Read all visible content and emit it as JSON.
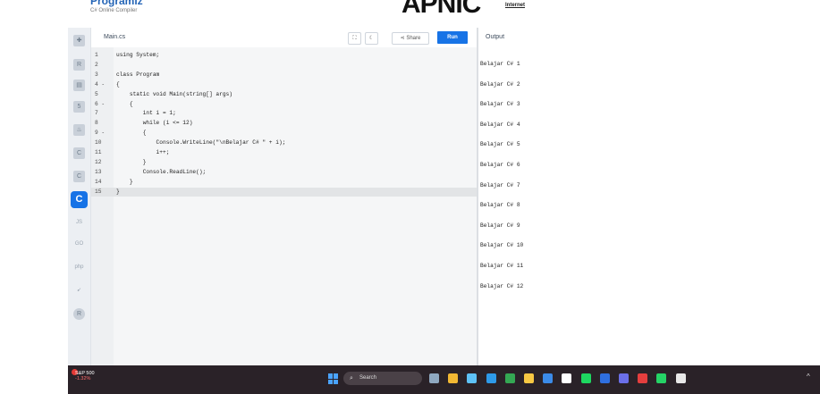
{
  "header": {
    "brand": "Programiz",
    "subtitle": "C# Online Compiler",
    "ad_logo": "APNIC",
    "ad_text": "Internet"
  },
  "sidebar": {
    "items": [
      {
        "icon": "python-icon",
        "glyph": "✚"
      },
      {
        "icon": "r-icon",
        "glyph": "R"
      },
      {
        "icon": "sql-icon",
        "glyph": "▤"
      },
      {
        "icon": "html-icon",
        "glyph": "5"
      },
      {
        "icon": "java-icon",
        "glyph": "♨"
      },
      {
        "icon": "c-icon",
        "glyph": "C"
      },
      {
        "icon": "cpp-icon",
        "glyph": "C"
      },
      {
        "icon": "csharp-icon",
        "glyph": "C"
      },
      {
        "icon": "js-icon",
        "glyph": "JS"
      },
      {
        "icon": "go-icon",
        "glyph": "GO"
      },
      {
        "icon": "php-icon",
        "glyph": "php"
      },
      {
        "icon": "swift-icon",
        "glyph": "➹"
      },
      {
        "icon": "rust-icon",
        "glyph": "R"
      }
    ]
  },
  "editor": {
    "filename": "Main.cs",
    "share_label": "Share",
    "run_label": "Run",
    "lines": [
      {
        "n": "1",
        "text": "using System;"
      },
      {
        "n": "2",
        "text": ""
      },
      {
        "n": "3",
        "text": "class Program"
      },
      {
        "n": "4 -",
        "text": "{"
      },
      {
        "n": "5",
        "text": "    static void Main(string[] args)"
      },
      {
        "n": "6 -",
        "text": "    {"
      },
      {
        "n": "7",
        "text": "        int i = 1;"
      },
      {
        "n": "8",
        "text": "        while (i <= 12)"
      },
      {
        "n": "9 -",
        "text": "        {"
      },
      {
        "n": "10",
        "text": "            Console.WriteLine(\"\\nBelajar C# \" + i);"
      },
      {
        "n": "11",
        "text": "            i++;"
      },
      {
        "n": "12",
        "text": "        }"
      },
      {
        "n": "13",
        "text": "        Console.ReadLine();"
      },
      {
        "n": "14",
        "text": "    }"
      },
      {
        "n": "15",
        "text": "}"
      }
    ]
  },
  "output": {
    "title": "Output",
    "lines": [
      "Belajar C# 1",
      "Belajar C# 2",
      "Belajar C# 3",
      "Belajar C# 4",
      "Belajar C# 5",
      "Belajar C# 6",
      "Belajar C# 7",
      "Belajar C# 8",
      "Belajar C# 9",
      "Belajar C# 10",
      "Belajar C# 11",
      "Belajar C# 12"
    ]
  },
  "taskbar": {
    "stock_name": "S&P 500",
    "stock_change": "-1.32%",
    "search_placeholder": "Search",
    "apps": [
      {
        "name": "tigers-widget-icon",
        "color": "#8fa8c0"
      },
      {
        "name": "file-explorer-icon",
        "color": "#f2b833"
      },
      {
        "name": "copilot-icon",
        "color": "#5ec2f7"
      },
      {
        "name": "edge-icon",
        "color": "#2e9ae8"
      },
      {
        "name": "chrome-icon",
        "color": "#34a853"
      },
      {
        "name": "folder-icon",
        "color": "#f7c843"
      },
      {
        "name": "files-icon",
        "color": "#3b8be8"
      },
      {
        "name": "store-icon",
        "color": "#ffffff"
      },
      {
        "name": "spotify-icon",
        "color": "#1ed760"
      },
      {
        "name": "launcher-icon",
        "color": "#2f6fe0"
      },
      {
        "name": "teams-icon",
        "color": "#6b6fe8"
      },
      {
        "name": "record-icon",
        "color": "#e53e3e"
      },
      {
        "name": "whatsapp-icon",
        "color": "#25d366"
      },
      {
        "name": "paint-icon",
        "color": "#e8e8e8"
      }
    ]
  },
  "colors": {
    "accent": "#1773e6",
    "taskbar": "#2a2228"
  }
}
